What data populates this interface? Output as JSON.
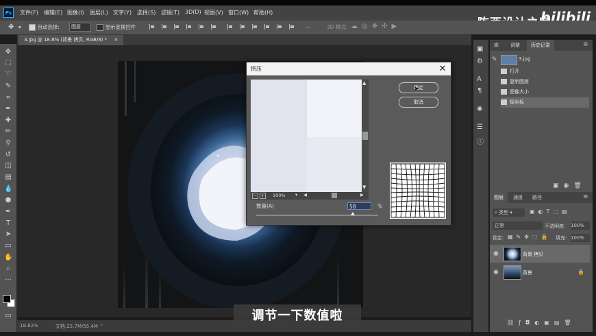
{
  "app": {
    "logo": "Ps"
  },
  "menu": [
    "文件(F)",
    "编辑(E)",
    "图像(I)",
    "图层(L)",
    "文字(Y)",
    "选择(S)",
    "滤镜(T)",
    "3D(D)",
    "视图(V)",
    "窗口(W)",
    "帮助(H)"
  ],
  "brand": {
    "text": "陈西设计之家",
    "logo_text": "bilibili"
  },
  "options": {
    "auto_select_label": "自动选择:",
    "auto_select_value": "图层",
    "show_transform_label": "显示变换控件",
    "mode3d_label": "3D 模式:",
    "more": "..."
  },
  "document": {
    "tab_title": "3.jpg @ 18.8% (背景 拷贝, RGB/8) *",
    "zoom": "18.82%",
    "docinfo": "文档:25.7M/55.4M"
  },
  "history_panel": {
    "tabs": [
      "库",
      "调整",
      "历史记录"
    ],
    "snapshot": "3.jpg",
    "items": [
      "打开",
      "复制图层",
      "图像大小",
      "极坐标"
    ]
  },
  "layers_panel": {
    "tabs": [
      "图层",
      "通道",
      "路径"
    ],
    "filter_kind": "类型",
    "blend_mode": "正常",
    "opacity_label": "不透明度:",
    "opacity_value": "100%",
    "lock_label": "锁定:",
    "fill_label": "填充:",
    "fill_value": "100%",
    "layers": [
      {
        "name": "背景 拷贝"
      },
      {
        "name": "背景"
      }
    ]
  },
  "dialog": {
    "title": "挤压",
    "ok": "确定",
    "cancel": "取消",
    "zoom": "100%",
    "amount_label": "数量(A)",
    "amount_value": "58",
    "amount_unit": "%",
    "amount_range": [
      -100,
      100
    ]
  },
  "subtitle": "调节一下数值啦",
  "colors": {
    "accent": "#31a8ff",
    "panel": "#535353",
    "dark": "#434343"
  }
}
